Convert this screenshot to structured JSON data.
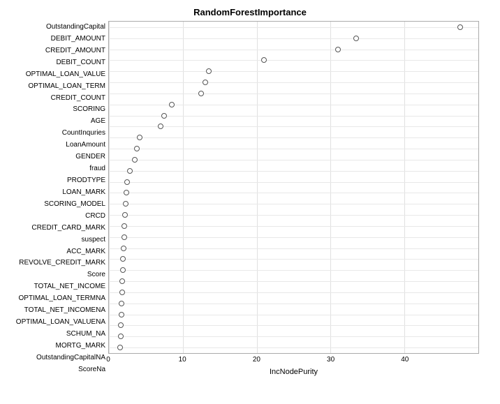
{
  "chart": {
    "title": "RandomForestImportance",
    "x_axis_label": "IncNodePurity",
    "x_ticks": [
      {
        "label": "0",
        "value": 0
      },
      {
        "label": "10",
        "value": 10
      },
      {
        "label": "20",
        "value": 20
      },
      {
        "label": "30",
        "value": 30
      },
      {
        "label": "40",
        "value": 40
      }
    ],
    "x_max": 50,
    "y_labels": [
      "OutstandingCapital",
      "DEBIT_AMOUNT",
      "CREDIT_AMOUNT",
      "DEBIT_COUNT",
      "OPTIMAL_LOAN_VALUE",
      "OPTIMAL_LOAN_TERM",
      "CREDIT_COUNT",
      "SCORING",
      "AGE",
      "CountInquries",
      "LoanAmount",
      "GENDER",
      "fraud",
      "PRODTYPE",
      "LOAN_MARK",
      "SCORING_MODEL",
      "CRCD",
      "CREDIT_CARD_MARK",
      "suspect",
      "ACC_MARK",
      "REVOLVE_CREDIT_MARK",
      "Score",
      "TOTAL_NET_INCOME",
      "OPTIMAL_LOAN_TERMNA",
      "TOTAL_NET_INCOMENA",
      "OPTIMAL_LOAN_VALUENA",
      "SCHUM_NA",
      "MORTG_MARK",
      "OutstandingCapitalNA",
      "ScoreNa"
    ],
    "dots": [
      {
        "label": "OutstandingCapital",
        "x": 47.5
      },
      {
        "label": "DEBIT_AMOUNT",
        "x": 33.5
      },
      {
        "label": "CREDIT_AMOUNT",
        "x": 31.0
      },
      {
        "label": "DEBIT_COUNT",
        "x": 21.0
      },
      {
        "label": "OPTIMAL_LOAN_VALUE",
        "x": 13.5
      },
      {
        "label": "OPTIMAL_LOAN_TERM",
        "x": 13.0
      },
      {
        "label": "CREDIT_COUNT",
        "x": 12.5
      },
      {
        "label": "SCORING",
        "x": 8.5
      },
      {
        "label": "AGE",
        "x": 7.5
      },
      {
        "label": "CountInquries",
        "x": 7.0
      },
      {
        "label": "LoanAmount",
        "x": 4.2
      },
      {
        "label": "GENDER",
        "x": 3.8
      },
      {
        "label": "fraud",
        "x": 3.5
      },
      {
        "label": "PRODTYPE",
        "x": 2.8
      },
      {
        "label": "LOAN_MARK",
        "x": 2.5
      },
      {
        "label": "SCORING_MODEL",
        "x": 2.4
      },
      {
        "label": "CRCD",
        "x": 2.3
      },
      {
        "label": "CREDIT_CARD_MARK",
        "x": 2.2
      },
      {
        "label": "suspect",
        "x": 2.1
      },
      {
        "label": "ACC_MARK",
        "x": 2.1
      },
      {
        "label": "REVOLVE_CREDIT_MARK",
        "x": 2.0
      },
      {
        "label": "Score",
        "x": 1.9
      },
      {
        "label": "TOTAL_NET_INCOME",
        "x": 1.9
      },
      {
        "label": "OPTIMAL_LOAN_TERMNA",
        "x": 1.8
      },
      {
        "label": "TOTAL_NET_INCOMENA",
        "x": 1.8
      },
      {
        "label": "OPTIMAL_LOAN_VALUENA",
        "x": 1.7
      },
      {
        "label": "SCHUM_NA",
        "x": 1.7
      },
      {
        "label": "MORTG_MARK",
        "x": 1.6
      },
      {
        "label": "OutstandingCapitalNA",
        "x": 1.6
      },
      {
        "label": "ScoreNa",
        "x": 1.5
      }
    ]
  }
}
